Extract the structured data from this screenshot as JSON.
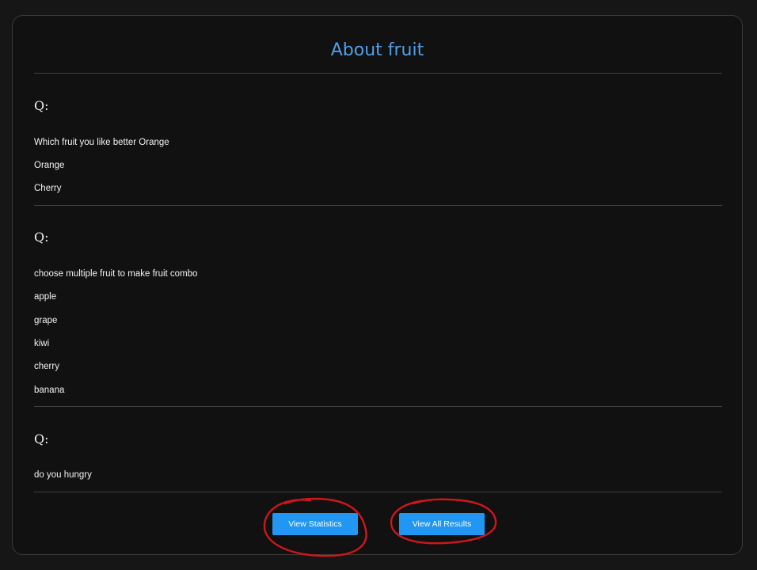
{
  "survey": {
    "title": "About fruit",
    "questions": [
      {
        "label": "Q:",
        "text": "Which fruit you like better Orange",
        "options": [
          "Orange",
          "Cherry"
        ]
      },
      {
        "label": "Q:",
        "text": "choose multiple fruit to make fruit combo",
        "options": [
          "apple",
          "grape",
          "kiwi",
          "cherry",
          "banana"
        ]
      },
      {
        "label": "Q:",
        "text": "do you hungry",
        "options": []
      }
    ]
  },
  "actions": {
    "view_statistics": "View Statistics",
    "view_all_results": "View All Results"
  },
  "colors": {
    "accent": "#2196f3",
    "title": "#4f9fe8",
    "annotation": "#d0161b"
  }
}
